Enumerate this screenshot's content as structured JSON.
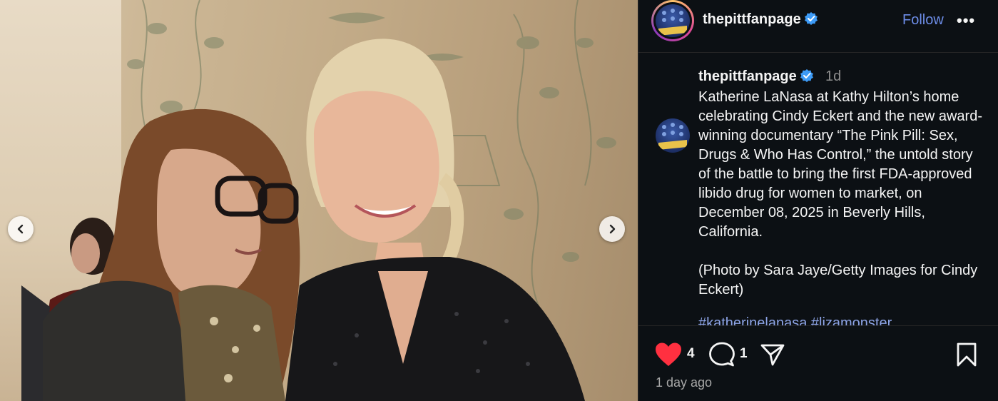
{
  "post": {
    "username": "thepittfanpage",
    "follow_label": "Follow",
    "more_label": "•••",
    "time_ago": "1d",
    "caption": "Katherine LaNasa at Kathy Hilton’s home celebrating Cindy Eckert and the new award-winning documentary “The Pink Pill: Sex, Drugs & Who Has Control,” the untold story of the battle to bring the first FDA-approved libido drug for women to market, on December 08, 2025 in Beverly Hills, California.\n\n(Photo by Sara Jaye/Getty Images for Cindy Eckert)",
    "hashtags_partial": "#katherinelanasa #lizamonster",
    "likes_count": "4",
    "comments_count": "1",
    "date_label": "1 day ago"
  },
  "colors": {
    "panel_bg": "#0c1014",
    "follow": "#6d8de8",
    "like": "#ff3040",
    "verified": "#3d9bf7"
  },
  "icons": {
    "prev": "chevron-left-icon",
    "next": "chevron-right-icon",
    "like": "heart-filled-icon",
    "comment": "comment-bubble-icon",
    "share": "paper-plane-icon",
    "save": "bookmark-icon",
    "verified": "verified-badge-icon"
  }
}
